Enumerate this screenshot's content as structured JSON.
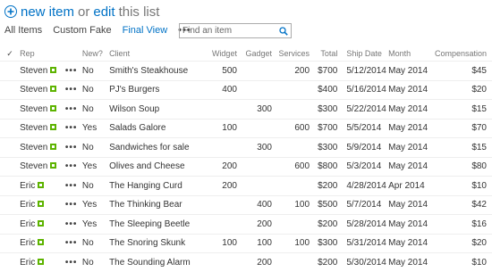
{
  "header": {
    "new_item_label": "new item",
    "or_label": "or",
    "edit_label": "edit",
    "rest_label": "this list"
  },
  "views": {
    "items": [
      "All Items",
      "Custom Fake",
      "Final View"
    ],
    "active_index": 2,
    "more_label": "•••"
  },
  "search": {
    "placeholder": "Find an item"
  },
  "table": {
    "columns": {
      "check": "✓",
      "rep": "Rep",
      "new": "New?",
      "client": "Client",
      "widget": "Widget",
      "gadget": "Gadget",
      "services": "Services",
      "total": "Total",
      "ship_date": "Ship Date",
      "month": "Month",
      "compensation": "Compensation"
    },
    "row_menu_label": "•••",
    "rows": [
      {
        "rep": "Steven",
        "new": "No",
        "client": "Smith's Steakhouse",
        "widget": "500",
        "gadget": "",
        "services": "200",
        "total": "$700",
        "ship_date": "5/12/2014",
        "month": "May 2014",
        "compensation": "$45"
      },
      {
        "rep": "Steven",
        "new": "No",
        "client": "PJ's Burgers",
        "widget": "400",
        "gadget": "",
        "services": "",
        "total": "$400",
        "ship_date": "5/16/2014",
        "month": "May 2014",
        "compensation": "$20"
      },
      {
        "rep": "Steven",
        "new": "No",
        "client": "Wilson Soup",
        "widget": "",
        "gadget": "300",
        "services": "",
        "total": "$300",
        "ship_date": "5/22/2014",
        "month": "May 2014",
        "compensation": "$15"
      },
      {
        "rep": "Steven",
        "new": "Yes",
        "client": "Salads Galore",
        "widget": "100",
        "gadget": "",
        "services": "600",
        "total": "$700",
        "ship_date": "5/5/2014",
        "month": "May 2014",
        "compensation": "$70"
      },
      {
        "rep": "Steven",
        "new": "No",
        "client": "Sandwiches for sale",
        "widget": "",
        "gadget": "300",
        "services": "",
        "total": "$300",
        "ship_date": "5/9/2014",
        "month": "May 2014",
        "compensation": "$15"
      },
      {
        "rep": "Steven",
        "new": "Yes",
        "client": "Olives and Cheese",
        "widget": "200",
        "gadget": "",
        "services": "600",
        "total": "$800",
        "ship_date": "5/3/2014",
        "month": "May 2014",
        "compensation": "$80"
      },
      {
        "rep": "Eric",
        "new": "No",
        "client": "The Hanging Curd",
        "widget": "200",
        "gadget": "",
        "services": "",
        "total": "$200",
        "ship_date": "4/28/2014",
        "month": "Apr 2014",
        "compensation": "$10"
      },
      {
        "rep": "Eric",
        "new": "Yes",
        "client": "The Thinking Bear",
        "widget": "",
        "gadget": "400",
        "services": "100",
        "total": "$500",
        "ship_date": "5/7/2014",
        "month": "May 2014",
        "compensation": "$42"
      },
      {
        "rep": "Eric",
        "new": "Yes",
        "client": "The Sleeping Beetle",
        "widget": "",
        "gadget": "200",
        "services": "",
        "total": "$200",
        "ship_date": "5/28/2014",
        "month": "May 2014",
        "compensation": "$16"
      },
      {
        "rep": "Eric",
        "new": "No",
        "client": "The Snoring Skunk",
        "widget": "100",
        "gadget": "100",
        "services": "100",
        "total": "$300",
        "ship_date": "5/31/2014",
        "month": "May 2014",
        "compensation": "$20"
      },
      {
        "rep": "Eric",
        "new": "No",
        "client": "The Sounding Alarm",
        "widget": "",
        "gadget": "200",
        "services": "",
        "total": "$200",
        "ship_date": "5/30/2014",
        "month": "May 2014",
        "compensation": "$10"
      }
    ]
  },
  "colors": {
    "accent": "#0072c6",
    "presence": "#5db300",
    "text": "#333333",
    "header_text": "#777777"
  }
}
